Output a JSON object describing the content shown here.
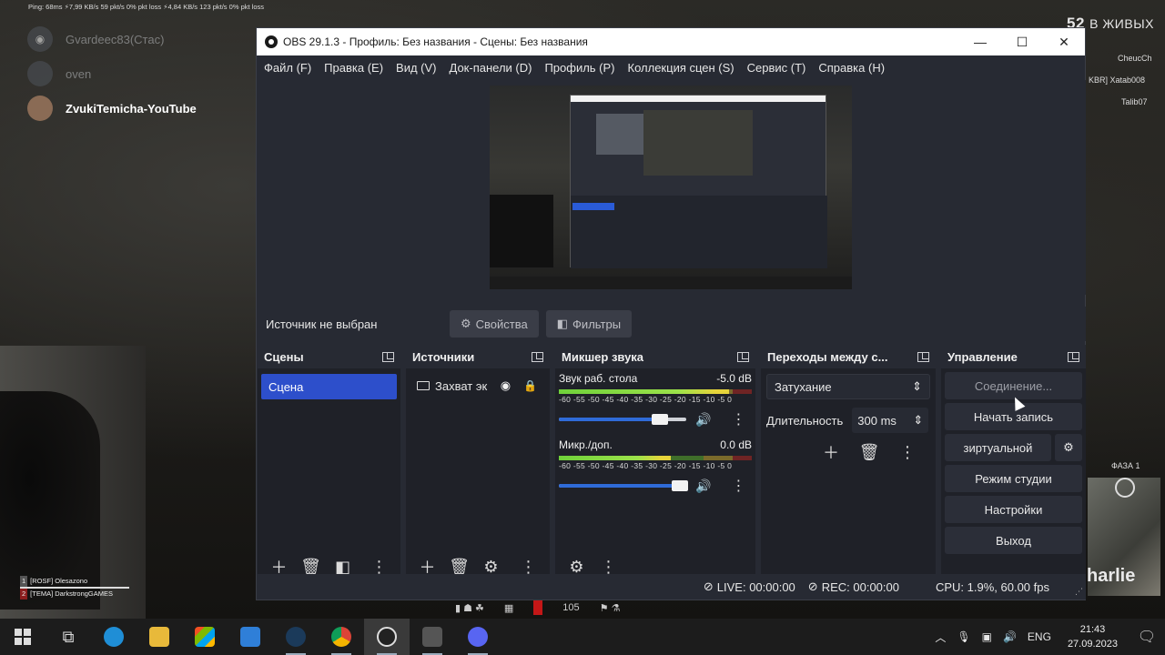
{
  "overlay": {
    "net_stats": "Ping: 68ms    ⚡7,99 KB/s    59 pkt/s    0% pkt loss    ⚡4,84 KB/s    123 pkt/s    0% pkt loss",
    "online_count": "52",
    "online_label": "В ЖИВЫХ",
    "discord_users": [
      {
        "name": "Gvardeec83(Стас)"
      },
      {
        "name": "oven"
      },
      {
        "name": "ZvukiTemicha-YouTube"
      }
    ],
    "side_names": [
      "CheucCh",
      "KBR] Xatab008",
      "Talib07"
    ],
    "phase_label": "ФАЗА 1",
    "team_label": "harlie",
    "kill_feed": [
      {
        "num": "1",
        "text": "[ROSF] Olesazono"
      },
      {
        "num": "2",
        "text": "[TEMA] DarkstrongGAMES"
      }
    ],
    "hud_number": "105"
  },
  "obs": {
    "window_title": "OBS 29.1.3 - Профиль: Без названия - Сцены: Без названия",
    "menu": [
      "Файл (F)",
      "Правка (E)",
      "Вид (V)",
      "Док-панели (D)",
      "Профиль (P)",
      "Коллекция сцен (S)",
      "Сервис (T)",
      "Справка (H)"
    ],
    "no_source": "Источник не выбран",
    "properties_label": "Свойства",
    "filters_label": "Фильтры",
    "scenes": {
      "title": "Сцены",
      "items": [
        "Сцена"
      ]
    },
    "sources": {
      "title": "Источники",
      "items": [
        "Захват эк"
      ]
    },
    "mixer": {
      "title": "Микшер звука",
      "channels": [
        {
          "name": "Звук раб. стола",
          "db": "-5.0 dB",
          "level": 0.88,
          "volume": 0.79
        },
        {
          "name": "Микр./доп.",
          "db": "0.0 dB",
          "level": 0.58,
          "volume": 0.95
        }
      ],
      "scale": "-60 -55 -50 -45 -40 -35 -30 -25 -20 -15 -10 -5 0"
    },
    "transitions": {
      "title": "Переходы между с...",
      "selected": "Затухание",
      "duration_label": "Длительность",
      "duration_value": "300 ms"
    },
    "controls": {
      "title": "Управление",
      "connect": "Соединение...",
      "record": "Начать запись",
      "virtual_cam": "зиртуальной",
      "studio": "Режим студии",
      "settings": "Настройки",
      "exit": "Выход"
    },
    "status": {
      "live": "LIVE: 00:00:00",
      "rec": "REC: 00:00:00",
      "cpu": "CPU: 1.9%, 60.00 fps"
    }
  },
  "taskbar": {
    "lang": "ENG",
    "time": "21:43",
    "date": "27.09.2023"
  }
}
